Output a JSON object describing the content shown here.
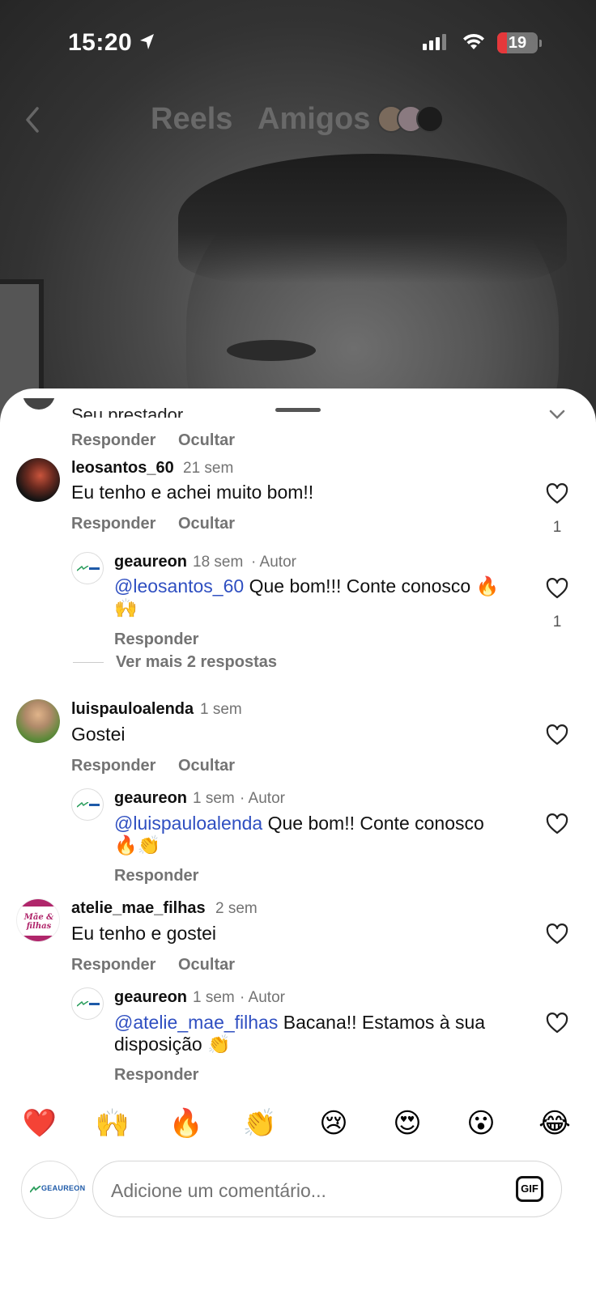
{
  "status_bar": {
    "time": "15:20",
    "battery": "19"
  },
  "top_nav": {
    "tabs": [
      "Reels",
      "Amigos"
    ]
  },
  "partial_comment": {
    "text": "Seu prestador",
    "actions": {
      "reply": "Responder",
      "hide": "Ocultar"
    }
  },
  "comments": [
    {
      "username": "leosantos_60",
      "time": "21 sem",
      "text": "Eu tenho e achei muito bom!!",
      "likes": "1",
      "actions": {
        "reply": "Responder",
        "hide": "Ocultar"
      },
      "reply": {
        "username": "geaureon",
        "time": "18 sem",
        "author_tag": "· Autor",
        "mention": "@leosantos_60",
        "text": " Que bom!!! Conte conosco 🔥",
        "text_line2": "🙌",
        "likes": "1",
        "reply_action": "Responder",
        "more_replies": "Ver mais 2 respostas"
      }
    },
    {
      "username": "luispauloalenda",
      "time": "1 sem",
      "text": "Gostei",
      "actions": {
        "reply": "Responder",
        "hide": "Ocultar"
      },
      "reply": {
        "username": "geaureon",
        "time": "1 sem",
        "author_tag": "· Autor",
        "mention": "@luispauloalenda",
        "text": " Que bom!! Conte conosco",
        "text_line2": "🔥👏",
        "reply_action": "Responder"
      }
    },
    {
      "username": "atelie_mae_filhas",
      "time": "2 sem",
      "text": "Eu tenho e gostei",
      "avatar_text": "Mãe & filhas",
      "actions": {
        "reply": "Responder",
        "hide": "Ocultar"
      },
      "reply": {
        "username": "geaureon",
        "time": "1 sem",
        "author_tag": "· Autor",
        "mention": "@atelie_mae_filhas",
        "text": " Bacana!! Estamos à sua",
        "text_line2": "disposição 👏",
        "reply_action": "Responder"
      }
    }
  ],
  "quick_reactions": [
    "❤️",
    "🙌",
    "🔥",
    "👏",
    "😢",
    "😍",
    "😮",
    "😂"
  ],
  "composer": {
    "placeholder": "Adicione um comentário...",
    "gif_label": "GIF",
    "avatar_logo_text": "GEAUREON"
  },
  "icons": {
    "location": "location-arrow-icon",
    "back": "chevron-left-icon",
    "heart": "heart-outline-icon",
    "chevron": "chevron-down-icon",
    "gif": "gif-icon",
    "wifi": "wifi-icon",
    "signal": "cellular-signal-icon"
  },
  "colors": {
    "mention": "#2f4fc1",
    "battery_low": "#e5383b",
    "heart_red": "#e0245e"
  }
}
